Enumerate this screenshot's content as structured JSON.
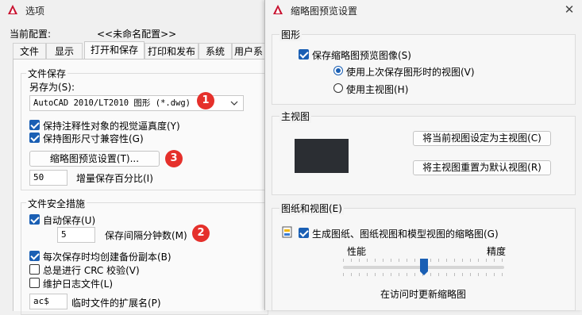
{
  "options": {
    "title": "选项",
    "profile_label": "当前配置:",
    "profile_value": "<<未命名配置>>",
    "tabs": [
      "文件",
      "显示",
      "打开和保存",
      "打印和发布",
      "系统",
      "用户系"
    ],
    "file_save": {
      "group_title": "文件保存",
      "save_as_label": "另存为(S):",
      "save_as_value": "AutoCAD 2010/LT2010 图形 (*.dwg)",
      "annotative_label": "保持注释性对象的视觉逼真度(Y)",
      "drawing_size_label": "保持图形尺寸兼容性(G)",
      "thumbnail_button": "缩略图预览设置(T)...",
      "increment_value": "50",
      "increment_label": "增量保存百分比(I)"
    },
    "safety": {
      "group_title": "文件安全措施",
      "autosave_label": "自动保存(U)",
      "minutes_value": "5",
      "minutes_label": "保存间隔分钟数(M)",
      "backup_label": "每次保存时均创建备份副本(B)",
      "crc_label": "总是进行 CRC 校验(V)",
      "log_label": "维护日志文件(L)",
      "ext_value": "ac$",
      "ext_label": "临时文件的扩展名(P)"
    },
    "badges": [
      "1",
      "2",
      "3"
    ]
  },
  "thumbnail": {
    "title": "缩略图预览设置",
    "close_glyph": "✕",
    "graphics": {
      "group_title": "图形",
      "save_preview_label": "保存缩略图预览图像(S)",
      "last_view_label": "使用上次保存图形时的视图(V)",
      "home_view_label": "使用主视图(H)"
    },
    "home_view": {
      "group_title": "主视图",
      "set_current_button": "将当前视图设定为主视图(C)",
      "reset_button": "将主视图重置为默认视图(R)"
    },
    "sheets": {
      "group_title": "图纸和视图(E)",
      "generate_label": "生成图纸、图纸视图和模型视图的缩略图(G)",
      "performance_label": "性能",
      "accuracy_label": "精度",
      "slider_caption": "在访问时更新缩略图",
      "slider_level": 0.5
    }
  },
  "colors": {
    "accent": "#1a5fb4",
    "badge": "#e5302b",
    "preview_bg": "#2b2e33"
  }
}
